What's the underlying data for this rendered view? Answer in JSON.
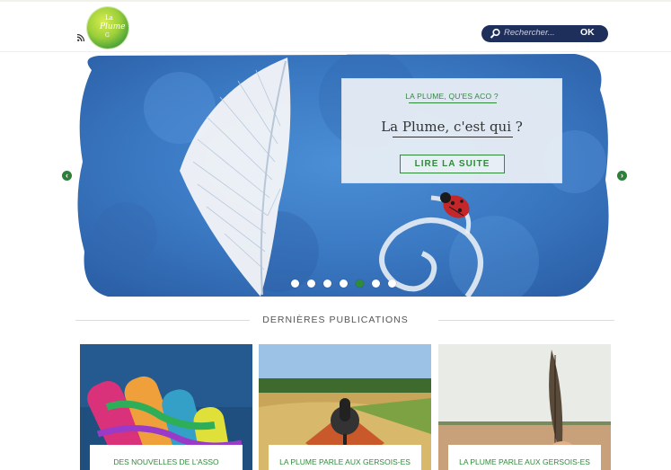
{
  "header": {
    "logo_text": [
      "La",
      "Plume",
      "G"
    ],
    "search": {
      "placeholder": "Rechercher...",
      "button_label": "OK"
    }
  },
  "hero": {
    "kicker": "LA PLUME, QU'ES ACO ?",
    "title": "La Plume, c'est qui ?",
    "button_label": "LIRE LA SUITE",
    "prev_arrow": "‹",
    "next_arrow": "›",
    "slide_count": 7,
    "active_slide": 5
  },
  "section": {
    "title": "DERNIÈRES PUBLICATIONS"
  },
  "posts": [
    {
      "caption": "DES NOUVELLES DE L'ASSO",
      "image": "painted-hands"
    },
    {
      "caption": "LA PLUME PARLE AUX GERSOIS-ES",
      "image": "microphone-field"
    },
    {
      "caption": "LA PLUME PARLE AUX GERSOIS-ES",
      "image": "feather-field"
    }
  ],
  "colors": {
    "accent": "#2f8a3a",
    "search_bg": "#1f2f5b",
    "hero_blue": "#3f7fc8"
  }
}
